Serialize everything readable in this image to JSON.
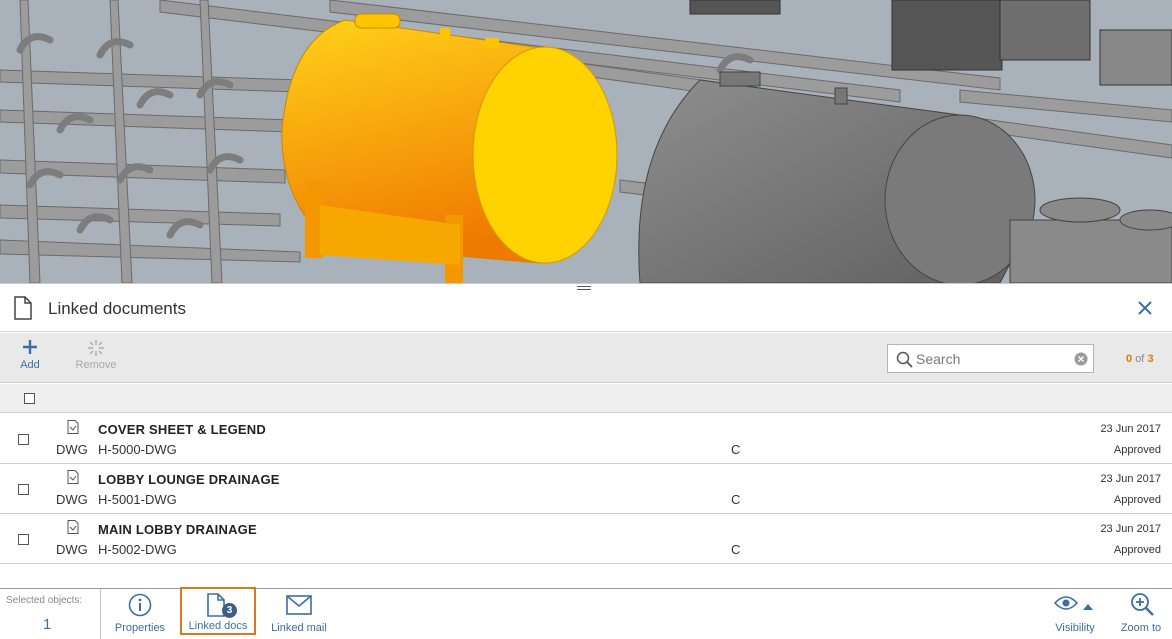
{
  "panel": {
    "title": "Linked documents"
  },
  "toolbar": {
    "add_label": "Add",
    "remove_label": "Remove",
    "search_placeholder": "Search",
    "count_current": "0",
    "count_of": "of",
    "count_total": "3"
  },
  "documents": [
    {
      "title": "COVER SHEET & LEGEND",
      "type": "DWG",
      "number": "H-5000-DWG",
      "revision": "C",
      "date": "23 Jun 2017",
      "status": "Approved"
    },
    {
      "title": "LOBBY LOUNGE DRAINAGE",
      "type": "DWG",
      "number": "H-5001-DWG",
      "revision": "C",
      "date": "23 Jun 2017",
      "status": "Approved"
    },
    {
      "title": "MAIN LOBBY DRAINAGE",
      "type": "DWG",
      "number": "H-5002-DWG",
      "revision": "C",
      "date": "23 Jun 2017",
      "status": "Approved"
    }
  ],
  "bottombar": {
    "selected_label": "Selected objects:",
    "selected_count": "1",
    "properties_label": "Properties",
    "linked_docs_label": "Linked docs",
    "linked_docs_badge": "3",
    "linked_mail_label": "Linked mail",
    "visibility_label": "Visibility",
    "zoom_label": "Zoom to"
  },
  "colors": {
    "accent": "#3a6ea5",
    "highlight_border": "#d97a1e",
    "selected_tank": "#f7b500",
    "count_highlight": "#e07b00"
  }
}
